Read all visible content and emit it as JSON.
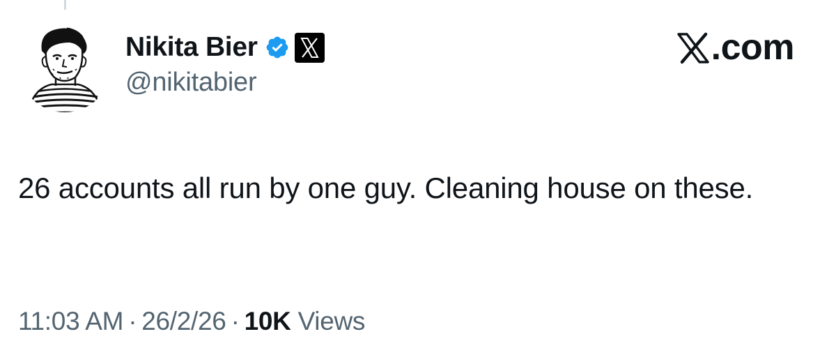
{
  "author": {
    "display_name": "Nikita Bier",
    "handle": "@nikitabier",
    "verified_badge": "verified-check-icon",
    "affiliate_badge": "x-logo-icon",
    "avatar": "sketch-portrait-avatar"
  },
  "brand": {
    "label": ".com",
    "logo": "x-logo-icon"
  },
  "tweet": {
    "text": "26 accounts all run by one guy. Cleaning house on these."
  },
  "meta": {
    "time": "11:03 AM",
    "separator": "·",
    "date": "26/2/26",
    "views_count": "10K",
    "views_label": "Views"
  },
  "colors": {
    "text_primary": "#0f1419",
    "text_secondary": "#536471",
    "verified_blue": "#1d9bf0",
    "thread_line": "#cfd9de"
  }
}
